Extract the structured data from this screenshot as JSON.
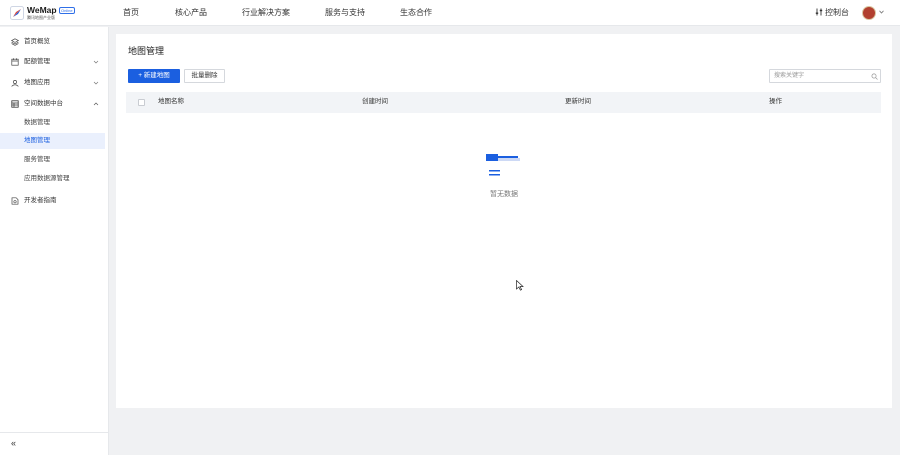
{
  "brand": {
    "name": "WeMap",
    "badge": "Online",
    "subtitle": "腾讯地图产业版"
  },
  "nav": {
    "items": [
      "首页",
      "核心产品",
      "行业解决方案",
      "服务与支持",
      "生态合作"
    ],
    "console": "控制台"
  },
  "sidebar": {
    "items": [
      {
        "label": "首页概览",
        "icon": "layers-icon",
        "has_caret": false
      },
      {
        "label": "配额管理",
        "icon": "calendar-icon",
        "has_caret": true
      },
      {
        "label": "地图应用",
        "icon": "map-pin-icon",
        "has_caret": true
      },
      {
        "label": "空间数据中台",
        "icon": "database-icon",
        "has_caret": true,
        "expanded": true
      }
    ],
    "sub_items": [
      {
        "label": "数据管理",
        "active": false
      },
      {
        "label": "地图管理",
        "active": true
      },
      {
        "label": "服务管理",
        "active": false
      },
      {
        "label": "应用数据源管理",
        "active": false
      }
    ],
    "dev_guide": "开发者指南",
    "collapse": "«"
  },
  "main": {
    "title": "地图管理",
    "new_button": "+ 新建地图",
    "batch_delete": "批量删除",
    "search_placeholder": "搜索关键字",
    "columns": [
      "地图名称",
      "创建时间",
      "更新时间",
      "操作"
    ],
    "empty_text": "暂无数据"
  },
  "colors": {
    "primary": "#1b5fe0",
    "active_bg": "#eaf0fd",
    "header_bg": "#f2f4f7"
  }
}
